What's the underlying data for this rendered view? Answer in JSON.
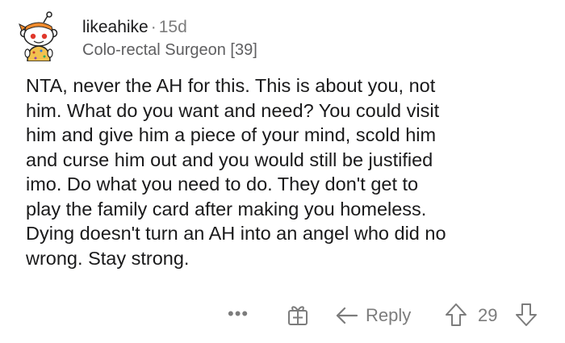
{
  "comment": {
    "author": "likeahike",
    "separator": "·",
    "age": "15d",
    "flair": "Colo-rectal Surgeon [39]",
    "avatar_icon": "snoo-avatar-icon",
    "body_lines": [
      "NTA, never the AH for this. This is about you, not",
      "him. What do you want and need? You could visit",
      "him and give him a piece of your mind, scold him",
      "and curse him out and you would still be justified",
      "imo. Do what you need to do. They don't get to",
      "play the family card after making you homeless.",
      "Dying doesn't turn an AH into an angel who did no",
      "wrong. Stay strong."
    ]
  },
  "actions": {
    "more_label": "•••",
    "gift_icon": "gift-icon",
    "reply_icon": "reply-arrow-icon",
    "reply_label": "Reply",
    "upvote_icon": "upvote-arrow-icon",
    "score": "29",
    "downvote_icon": "downvote-arrow-icon"
  },
  "colors": {
    "text": "#1a1a1b",
    "muted": "#7c7c7c",
    "flair": "#5f5f61",
    "avatar_headband": "#f08a2c",
    "avatar_eye": "#e0372b",
    "avatar_shirt": "#f2c14e"
  }
}
